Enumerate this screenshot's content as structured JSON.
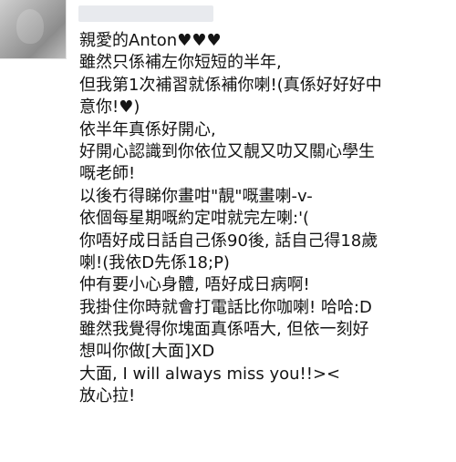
{
  "post": {
    "lines": [
      "親愛的Anton♥♥♥",
      "雖然只係補左你短短的半年,",
      "但我第1次補習就係補你喇!(真係好好好中",
      "意你!♥)",
      "依半年真係好開心,",
      "好開心認識到你依位又靚又叻又關心學生",
      "嘅老師!",
      "以後冇得睇你畫咁\"靚\"嘅畫喇-v-",
      "依個每星期嘅約定咁就完左喇:'(",
      "你唔好成日話自己係90後, 話自己得18歲",
      "喇!(我依D先係18;P)",
      "仲有要小心身體, 唔好成日病啊!",
      "我掛住你時就會打電話比你咖喇! 哈哈:D",
      "雖然我覺得你塊面真係唔大, 但依一刻好",
      "想叫你做[大面]XD",
      "大面, I will always miss you!!><",
      "放心拉!"
    ]
  }
}
